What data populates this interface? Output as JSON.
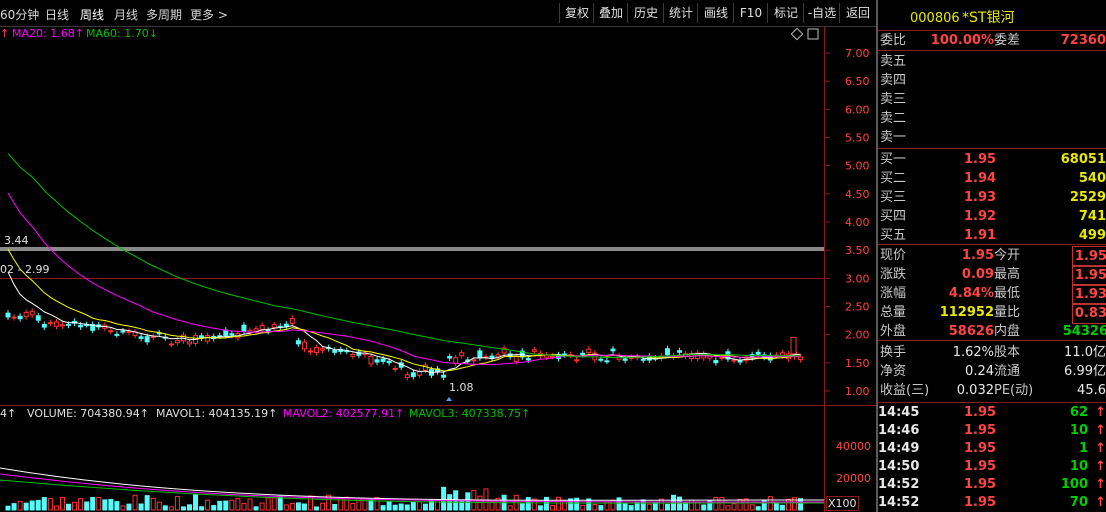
{
  "toolbar": {
    "periods": [
      "60分钟",
      "日线",
      "周线",
      "月线",
      "多周期",
      "更多 >"
    ],
    "active_period": "周线",
    "buttons": [
      "复权",
      "叠加",
      "历史",
      "统计",
      "画线",
      "F10",
      "标记",
      "-自选",
      "返回"
    ]
  },
  "main_chart": {
    "legend": {
      "ma20_arrow": "↑",
      "ma20": "MA20: 1.68↑",
      "ma60": "MA60: 1.70↓"
    },
    "price_ticks": [
      "7.00",
      "6.50",
      "6.00",
      "5.50",
      "5.00",
      "4.50",
      "4.00",
      "3.50",
      "3.00",
      "2.50",
      "2.00",
      "1.50",
      "1.00"
    ],
    "annotations": {
      "high_left": "3.44",
      "level_left": "02 - 2.99",
      "low": "1.08"
    },
    "colors": {
      "up": "#ff3232",
      "down": "#54fcfc",
      "ma5": "#ffffff",
      "ma10": "#ffff00",
      "ma20": "#ff00ff",
      "ma60": "#00c000",
      "grid": "#8b1a1a"
    }
  },
  "volume_chart": {
    "legend": {
      "prefix": "4↑",
      "volume": "VOLUME: 704380.94↑",
      "mavol1": "MAVOL1: 404135.19↑",
      "mavol2": "MAVOL2: 402577.91↑",
      "mavol3": "MAVOL3: 407338.75↑"
    },
    "ticks": [
      "40000",
      "20000"
    ],
    "unit": "X100"
  },
  "quote": {
    "code": "000806",
    "name": "*ST银河",
    "weibi_label": "委比",
    "weibi": "100.00%",
    "weicha_label": "委差",
    "weicha": "72360",
    "asks": [
      {
        "label": "卖五",
        "price": "",
        "vol": ""
      },
      {
        "label": "卖四",
        "price": "",
        "vol": ""
      },
      {
        "label": "卖三",
        "price": "",
        "vol": ""
      },
      {
        "label": "卖二",
        "price": "",
        "vol": ""
      },
      {
        "label": "卖一",
        "price": "",
        "vol": ""
      }
    ],
    "bids": [
      {
        "label": "买一",
        "price": "1.95",
        "vol": "68051"
      },
      {
        "label": "买二",
        "price": "1.94",
        "vol": "540"
      },
      {
        "label": "买三",
        "price": "1.93",
        "vol": "2529"
      },
      {
        "label": "买四",
        "price": "1.92",
        "vol": "741"
      },
      {
        "label": "买五",
        "price": "1.91",
        "vol": "499"
      }
    ],
    "stats": [
      {
        "l1": "现价",
        "v1": "1.95",
        "l2": "今开",
        "v2": "1.95"
      },
      {
        "l1": "涨跌",
        "v1": "0.09",
        "l2": "最高",
        "v2": "1.95"
      },
      {
        "l1": "涨幅",
        "v1": "4.84%",
        "l2": "最低",
        "v2": "1.93"
      },
      {
        "l1": "总量",
        "v1": "112952",
        "l2": "量比",
        "v2": "0.83"
      },
      {
        "l1": "外盘",
        "v1": "58626",
        "l2": "内盘",
        "v2": "54326"
      }
    ],
    "stats2": [
      {
        "l1": "换手",
        "v1": "1.62%",
        "l2": "股本",
        "v2": "11.0亿"
      },
      {
        "l1": "净资",
        "v1": "0.24",
        "l2": "流通",
        "v2": "6.99亿"
      },
      {
        "l1": "收益(三)",
        "v1": "0.032",
        "l2": "PE(动)",
        "v2": "45.6"
      }
    ],
    "ticks": [
      {
        "time": "14:45",
        "price": "1.95",
        "vol": "62",
        "arrow": "↑"
      },
      {
        "time": "14:46",
        "price": "1.95",
        "vol": "10",
        "arrow": "↑"
      },
      {
        "time": "14:49",
        "price": "1.95",
        "vol": "1",
        "arrow": "↑"
      },
      {
        "time": "14:50",
        "price": "1.95",
        "vol": "10",
        "arrow": "↑"
      },
      {
        "time": "14:52",
        "price": "1.95",
        "vol": "100",
        "arrow": "↑"
      },
      {
        "time": "14:52",
        "price": "1.95",
        "vol": "70",
        "arrow": "↑"
      }
    ]
  }
}
